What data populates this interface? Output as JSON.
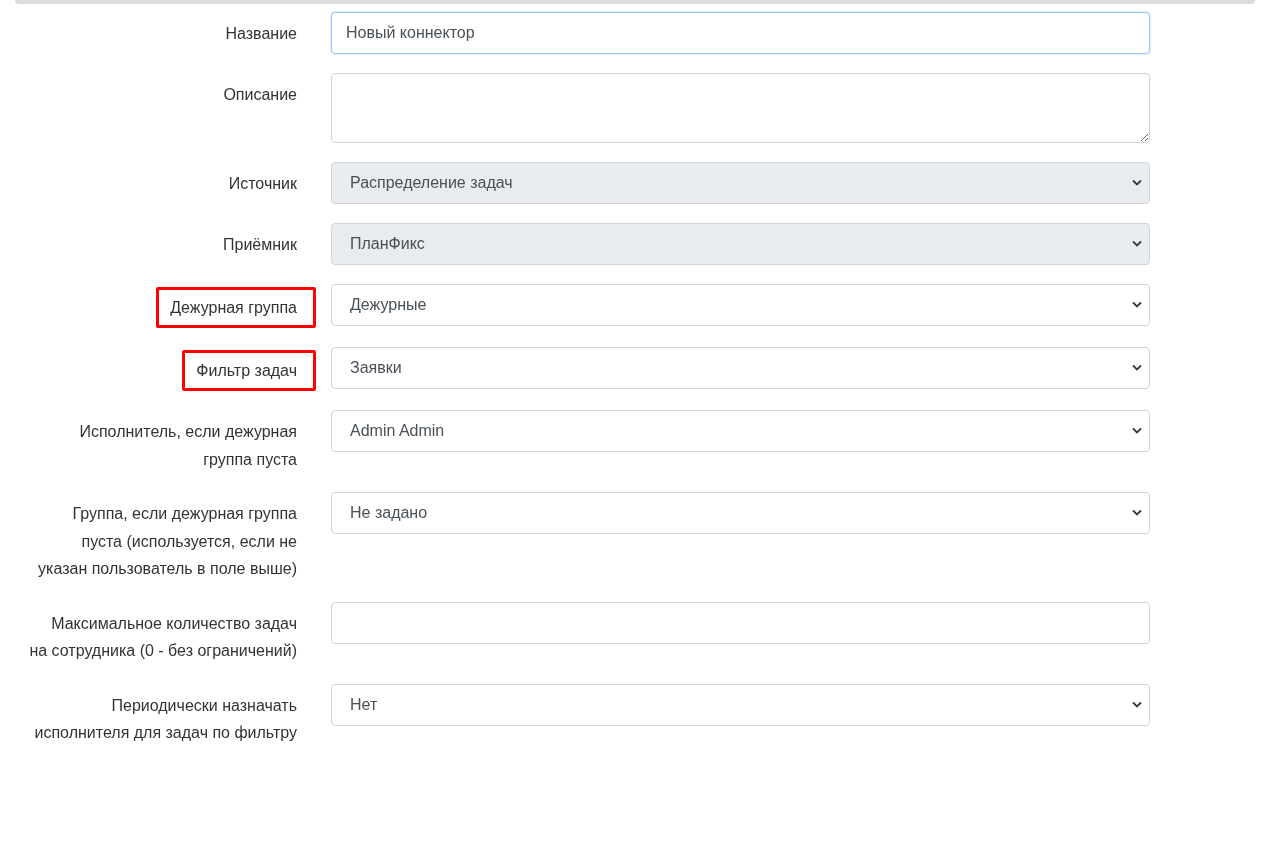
{
  "fields": [
    {
      "label": "Название",
      "kind": "input",
      "value": "Новый коннектор",
      "focused": true,
      "highlighted": false,
      "disabled": false
    },
    {
      "label": "Описание",
      "kind": "textarea",
      "focused": false,
      "highlighted": false,
      "disabled": false
    },
    {
      "label": "Источник",
      "kind": "select",
      "value": "Распределение задач",
      "focused": false,
      "highlighted": false,
      "disabled": true
    },
    {
      "label": "Приёмник",
      "kind": "select",
      "value": "ПланФикс",
      "focused": false,
      "highlighted": false,
      "disabled": true
    },
    {
      "label": "Дежурная группа",
      "kind": "select",
      "value": "Дежурные",
      "focused": false,
      "highlighted": true,
      "disabled": false
    },
    {
      "label": "Фильтр задач",
      "kind": "select",
      "value": "Заявки",
      "focused": false,
      "highlighted": true,
      "disabled": false
    },
    {
      "label": "Исполнитель, если дежурная группа пуста",
      "kind": "select",
      "value": "Admin Admin",
      "focused": false,
      "highlighted": false,
      "disabled": false
    },
    {
      "label": "Группа, если дежурная группа пуста (используется, если не указан пользователь в поле выше)",
      "kind": "select",
      "value": "Не задано",
      "focused": false,
      "highlighted": false,
      "disabled": false
    },
    {
      "label": "Максимальное количество задач на сотрудника (0 - без ограничений)",
      "kind": "input",
      "focused": false,
      "highlighted": false,
      "disabled": false
    },
    {
      "label": "Периодически назначать исполнителя для задач по фильтру",
      "kind": "select",
      "value": "Нет",
      "focused": false,
      "highlighted": false,
      "disabled": false
    }
  ]
}
